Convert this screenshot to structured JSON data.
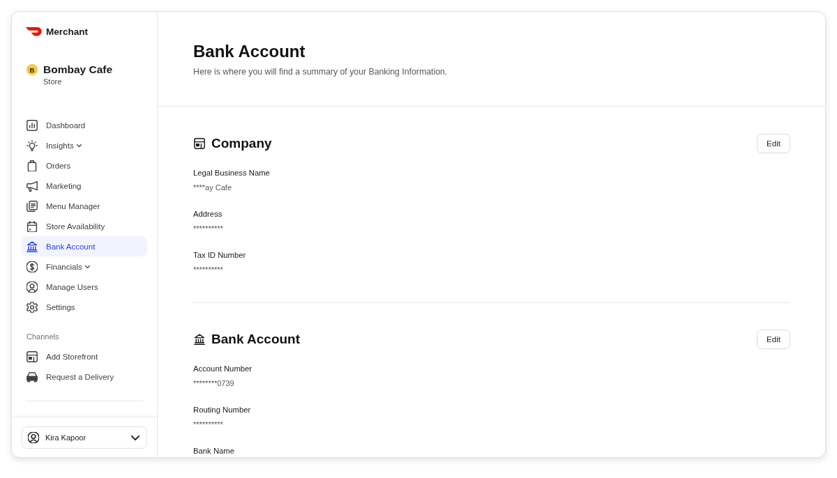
{
  "brand": {
    "name": "Merchant"
  },
  "store": {
    "initial": "B",
    "name": "Bombay Cafe",
    "type": "Store"
  },
  "nav": [
    {
      "label": "Dashboard",
      "kind": "link",
      "selected": false
    },
    {
      "label": "Insights",
      "kind": "group",
      "selected": false
    },
    {
      "label": "Orders",
      "kind": "link",
      "selected": false
    },
    {
      "label": "Marketing",
      "kind": "link",
      "selected": false
    },
    {
      "label": "Menu Manager",
      "kind": "link",
      "selected": false
    },
    {
      "label": "Store Availability",
      "kind": "link",
      "selected": false
    },
    {
      "label": "Bank Account",
      "kind": "link",
      "selected": true
    },
    {
      "label": "Financials",
      "kind": "group",
      "selected": false
    },
    {
      "label": "Manage Users",
      "kind": "link",
      "selected": false
    },
    {
      "label": "Settings",
      "kind": "link",
      "selected": false
    }
  ],
  "channels": {
    "heading": "Channels",
    "items": [
      {
        "label": "Add Storefront",
        "selected": false
      },
      {
        "label": "Request a Delivery",
        "selected": false
      }
    ]
  },
  "user_menu": {
    "name": "Kira Kapoor"
  },
  "page": {
    "title": "Bank Account",
    "subtitle": "Here is where you will find a summary of your Banking Information."
  },
  "sections": [
    {
      "title": "Company",
      "action": "Edit",
      "fields": [
        {
          "label": "Legal Business Name",
          "value": "****ay Cafe"
        },
        {
          "label": "Address",
          "value": "**********"
        },
        {
          "label": "Tax ID Number",
          "value": "**********"
        }
      ]
    },
    {
      "title": "Bank Account",
      "action": "Edit",
      "fields": [
        {
          "label": "Account Number",
          "value": "********0739"
        },
        {
          "label": "Routing Number",
          "value": "**********"
        },
        {
          "label": "Bank Name"
        }
      ]
    }
  ]
}
